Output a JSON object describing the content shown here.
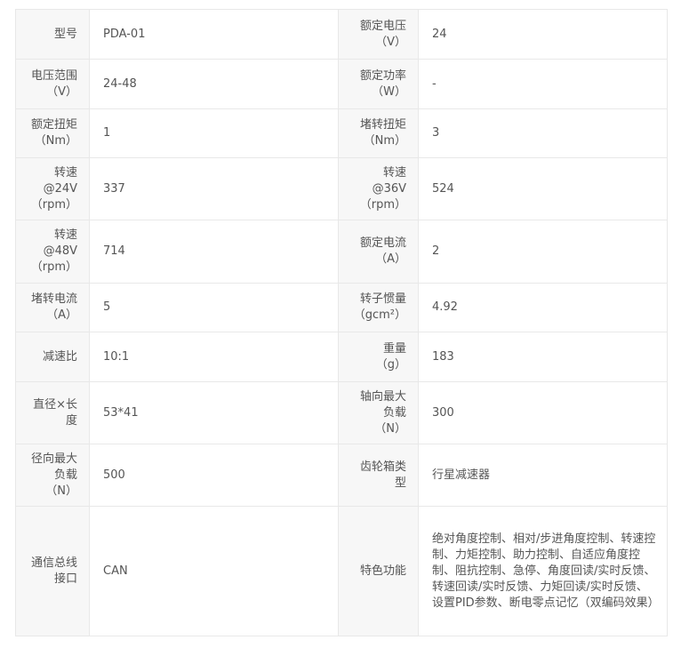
{
  "rows": [
    {
      "l1": "型号",
      "v1": "PDA-01",
      "l2": "额定电压\n（V）",
      "v2": "24"
    },
    {
      "l1": "电压范围\n（V）",
      "v1": "24-48",
      "l2": "额定功率\n（W）",
      "v2": "-"
    },
    {
      "l1": "额定扭矩\n（Nm）",
      "v1": "1",
      "l2": "堵转扭矩\n（Nm）",
      "v2": "3"
    },
    {
      "l1": "转速\n@24V\n（rpm）",
      "v1": "337",
      "l2": "转速\n@36V\n（rpm）",
      "v2": "524"
    },
    {
      "l1": "转速\n@48V\n（rpm）",
      "v1": "714",
      "l2": "额定电流\n（A）",
      "v2": "2"
    },
    {
      "l1": "堵转电流\n（A）",
      "v1": "5",
      "l2": "转子惯量\n（gcm²）",
      "v2": "4.92"
    },
    {
      "l1": "减速比",
      "v1": "10:1",
      "l2": "重量\n（g）",
      "v2": "183"
    },
    {
      "l1": "直径×长\n度",
      "v1": "53*41",
      "l2": "轴向最大\n负载\n（N）",
      "v2": "300"
    },
    {
      "l1": "径向最大\n负载\n（N）",
      "v1": "500",
      "l2": "齿轮箱类\n型",
      "v2": "行星减速器"
    },
    {
      "l1": "通信总线\n接口",
      "v1": "CAN",
      "l2": "特色功能",
      "v2": "绝对角度控制、相对/步进角度控制、转速控制、力矩控制、助力控制、自适应角度控制、阻抗控制、急停、角度回读/实时反馈、转速回读/实时反馈、力矩回读/实时反馈、设置PID参数、断电零点记忆（双编码效果）"
    }
  ]
}
